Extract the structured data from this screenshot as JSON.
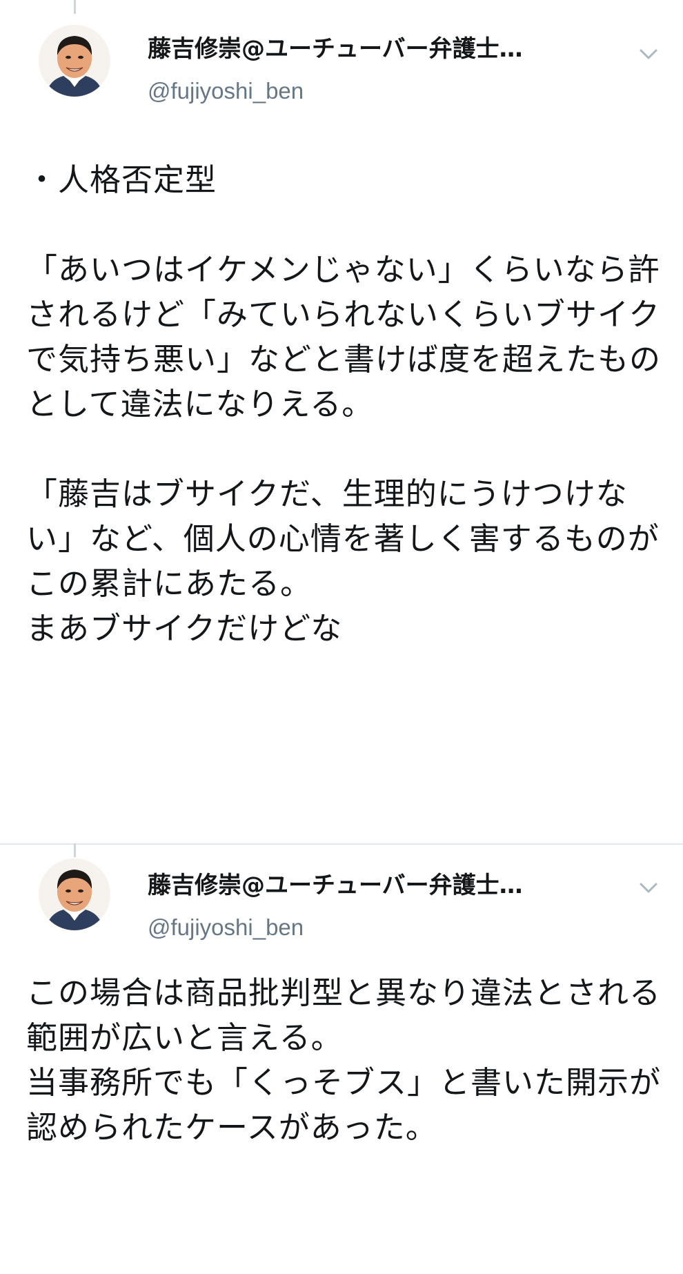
{
  "tweets": [
    {
      "display_name": "藤吉修崇@ユーチューバー弁護士…",
      "handle": "@fujiyoshi_ben",
      "text": "・人格否定型\n\n「あいつはイケメンじゃない」くらいなら許されるけど「みていられないくらいブサイクで気持ち悪い」などと書けば度を超えたものとして違法になりえる。\n\n「藤吉はブサイクだ、生理的にうけつけない」など、個人の心情を著しく害するものがこの累計にあたる。\nまあブサイクだけどな",
      "chevron_icon": "chevron-down-icon"
    },
    {
      "display_name": "藤吉修崇@ユーチューバー弁護士…",
      "handle": "@fujiyoshi_ben",
      "text": "この場合は商品批判型と異なり違法とされる範囲が広いと言える。\n当事務所でも「くっそブス」と書いた開示が認められたケースがあった。",
      "chevron_icon": "chevron-down-icon"
    }
  ],
  "colors": {
    "text": "#14171a",
    "secondary": "#657786",
    "divider": "#e1e8ed",
    "chevron": "#aab8c2"
  }
}
